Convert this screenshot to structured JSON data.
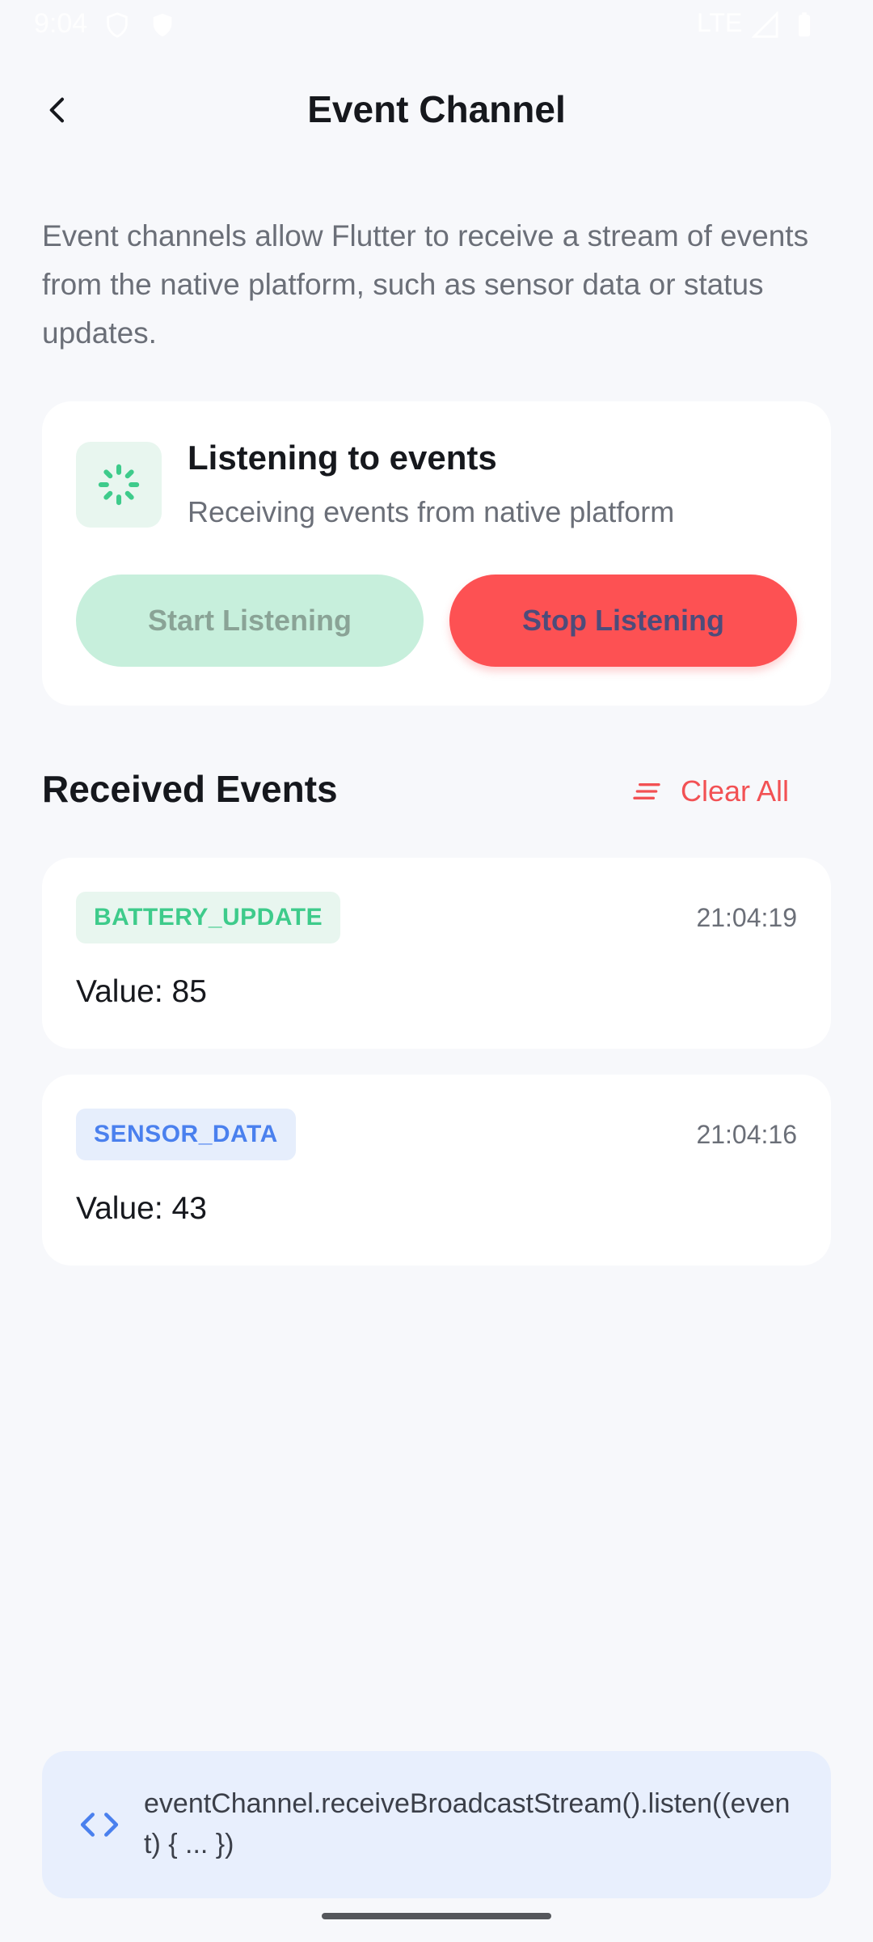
{
  "status_bar": {
    "time": "9:04",
    "network": "LTE",
    "icons": [
      "shield-icon",
      "play-protect-icon",
      "signal-icon",
      "battery-icon"
    ]
  },
  "app_bar": {
    "title": "Event Channel",
    "back_icon": "back-arrow-icon"
  },
  "description": "Event channels allow Flutter to receive a stream of events from the native platform, such as sensor data or status updates.",
  "listen_card": {
    "icon": "loading-spinner-icon",
    "title": "Listening to events",
    "subtitle": "Receiving events from native platform",
    "start_label": "Start Listening",
    "stop_label": "Stop Listening"
  },
  "events_section": {
    "title": "Received Events",
    "clear_label": "Clear All",
    "clear_icon": "clear-all-icon"
  },
  "events": [
    {
      "type": "BATTERY_UPDATE",
      "time": "21:04:19",
      "value": "Value: 85"
    },
    {
      "type": "SENSOR_DATA",
      "time": "21:04:16",
      "value": "Value: 43"
    }
  ],
  "code": {
    "icon": "code-icon",
    "text": "eventChannel.receiveBroadcastStream().listen((event) { ... })"
  },
  "colors": {
    "background": "#f7f8fb",
    "accent_green": "#3ecb8b",
    "accent_red": "#fd5153",
    "accent_blue": "#4a80ee"
  }
}
